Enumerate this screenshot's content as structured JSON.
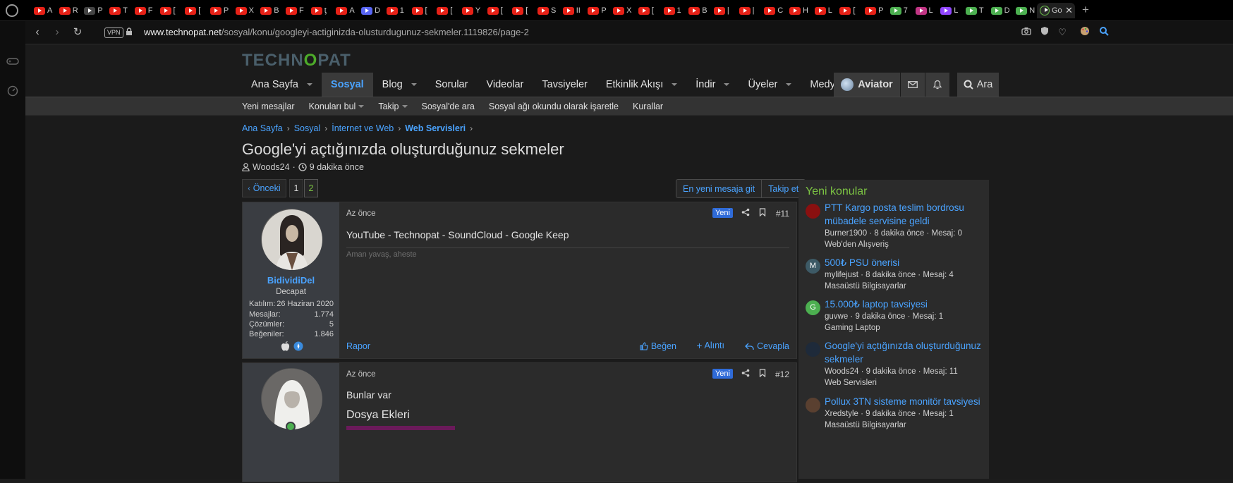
{
  "browser": {
    "tabs": [
      {
        "label": "A"
      },
      {
        "label": "R"
      },
      {
        "label": "P"
      },
      {
        "label": "T"
      },
      {
        "label": "F"
      },
      {
        "label": "["
      },
      {
        "label": "["
      },
      {
        "label": "P"
      },
      {
        "label": "X"
      },
      {
        "label": "B"
      },
      {
        "label": "F"
      },
      {
        "label": "ţ"
      },
      {
        "label": "A"
      },
      {
        "label": "D"
      },
      {
        "label": "1"
      },
      {
        "label": "["
      },
      {
        "label": "["
      },
      {
        "label": "Y"
      },
      {
        "label": "["
      },
      {
        "label": "["
      },
      {
        "label": "S"
      },
      {
        "label": "II"
      },
      {
        "label": "P"
      },
      {
        "label": "X"
      },
      {
        "label": "["
      },
      {
        "label": "1"
      },
      {
        "label": "B"
      },
      {
        "label": "|"
      },
      {
        "label": "|"
      },
      {
        "label": "C"
      },
      {
        "label": "H"
      },
      {
        "label": "L"
      },
      {
        "label": "["
      },
      {
        "label": "P"
      },
      {
        "label": "7"
      },
      {
        "label": "L"
      },
      {
        "label": "L"
      },
      {
        "label": "T"
      },
      {
        "label": "D"
      },
      {
        "label": "N"
      }
    ],
    "active_tab": "Go",
    "new_tab_symbol": "+",
    "close_symbol": "✕",
    "vpn_label": "VPN",
    "url_domain": "www.technopat.net",
    "url_path": "/sosyal/konu/googleyi-actiginizda-olusturdugunuz-sekmeler.1119826/page-2"
  },
  "site": {
    "logo_part1": "TECHN",
    "logo_part2": "O",
    "logo_part3": "PAT",
    "nav": [
      {
        "label": "Ana Sayfa",
        "caret": true
      },
      {
        "label": "Sosyal",
        "caret": false,
        "active": true
      },
      {
        "label": "Blog",
        "caret": true
      },
      {
        "label": "Sorular",
        "caret": false
      },
      {
        "label": "Videolar",
        "caret": false
      },
      {
        "label": "Tavsiyeler",
        "caret": false
      },
      {
        "label": "Etkinlik Akışı",
        "caret": true
      },
      {
        "label": "İndir",
        "caret": true
      },
      {
        "label": "Üyeler",
        "caret": true
      },
      {
        "label": "Medya",
        "caret": true
      }
    ],
    "account_label": "Aviator",
    "search_label": "Ara",
    "subnav": [
      {
        "label": "Yeni mesajlar"
      },
      {
        "label": "Konuları bul",
        "caret": true
      },
      {
        "label": "Takip",
        "caret": true
      },
      {
        "label": "Sosyal'de ara"
      },
      {
        "label": "Sosyal ağı okundu olarak işaretle"
      },
      {
        "label": "Kurallar"
      }
    ],
    "breadcrumbs": [
      "Ana Sayfa",
      "Sosyal",
      "İnternet ve Web",
      "Web Servisleri"
    ],
    "thread_title": "Google'yi açtığınızda oluşturduğunuz sekmeler",
    "thread_author": "Woods24",
    "thread_time": "9 dakika önce",
    "pager": {
      "prev_label": "Önceki",
      "pages": [
        "1",
        "2"
      ],
      "current": "2"
    },
    "top_buttons": {
      "latest": "En yeni mesaja git",
      "follow": "Takip et"
    },
    "posts": [
      {
        "username": "BidividiDel",
        "user_title": "Decapat",
        "stats": [
          {
            "label": "Katılım:",
            "value": "26 Haziran 2020"
          },
          {
            "label": "Mesajlar:",
            "value": "1.774"
          },
          {
            "label": "Çözümler:",
            "value": "5"
          },
          {
            "label": "Beğeniler:",
            "value": "1.846"
          }
        ],
        "time": "Az önce",
        "badge": "Yeni",
        "number": "#11",
        "text": "YouTube - Technopat - SoundCloud - Google Keep",
        "signature": "Aman yavaş, aheste",
        "report": "Rapor",
        "like": "Beğen",
        "quote": "Alıntı",
        "reply": "Cevapla"
      },
      {
        "time": "Az önce",
        "badge": "Yeni",
        "number": "#12",
        "text": "Bunlar var",
        "attachments_title": "Dosya Ekleri"
      }
    ],
    "sidebar": {
      "heading": "Yeni konular",
      "topics": [
        {
          "title": "PTT Kargo posta teslim bordrosu mübadele servisine geldi",
          "meta": "Burner1900 · 8 dakika önce · Mesaj: 0",
          "forum": "Web'den Alışveriş",
          "avatar": "",
          "avatar_color": "#8a1010"
        },
        {
          "title": "500₺ PSU önerisi",
          "meta": "mylifejust · 8 dakika önce · Mesaj: 4",
          "forum": "Masaüstü Bilgisayarlar",
          "avatar": "M",
          "avatar_color": "#3d5a66"
        },
        {
          "title": "15.000₺ laptop tavsiyesi",
          "meta": "guvwe · 9 dakika önce · Mesaj: 1",
          "forum": "Gaming Laptop",
          "avatar": "G",
          "avatar_color": "#4caf50"
        },
        {
          "title": "Google'yi açtığınızda oluşturduğunuz sekmeler",
          "meta": "Woods24 · 9 dakika önce · Mesaj: 11",
          "forum": "Web Servisleri",
          "avatar": "",
          "avatar_color": "#1e2a3a"
        },
        {
          "title": "Pollux 3TN sisteme monitör tavsiyesi",
          "meta": "Xredstyle · 9 dakika önce · Mesaj: 1",
          "forum": "Masaüstü Bilgisayarlar",
          "avatar": "",
          "avatar_color": "#5a4030"
        }
      ]
    }
  }
}
